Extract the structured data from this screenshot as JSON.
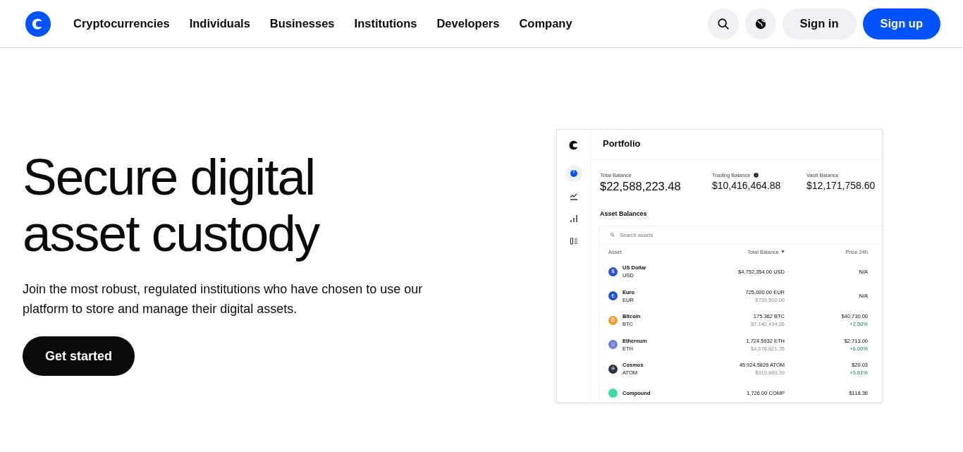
{
  "nav": {
    "links": [
      "Cryptocurrencies",
      "Individuals",
      "Businesses",
      "Institutions",
      "Developers",
      "Company"
    ],
    "sign_in": "Sign in",
    "sign_up": "Sign up"
  },
  "hero": {
    "title_lines": [
      "Secure digital",
      "asset custody"
    ],
    "subtitle": "Join the most robust, regulated institutions who have chosen to use our platform to store and manage their digital assets.",
    "cta": "Get started"
  },
  "portfolio": {
    "title": "Portfolio",
    "sidebar": [
      {
        "kind": "pie",
        "selected": true
      },
      {
        "kind": "trend",
        "selected": false
      },
      {
        "kind": "bars",
        "selected": false
      },
      {
        "kind": "list",
        "selected": false
      }
    ],
    "balances": [
      {
        "label": "Total Balance",
        "value": "$22,588,223.48",
        "info": false,
        "primary": true
      },
      {
        "label": "Trading Balance",
        "value": "$10,416,464.88",
        "info": true,
        "primary": false
      },
      {
        "label": "Vault Balance",
        "value": "$12,171,758.60",
        "info": false,
        "primary": false
      }
    ],
    "section_title": "Asset Balances",
    "search": {
      "placeholder": "Search assets"
    },
    "columns": [
      "Asset",
      "Total Balance",
      "Price 24h"
    ],
    "rows": [
      {
        "name": "US Dollar",
        "symbol": "USD",
        "glyph": "$",
        "color": "#2b50d8",
        "amount": "$4,752,354.00 USD",
        "fiat": "",
        "price": "N/A",
        "change": ""
      },
      {
        "name": "Euro",
        "symbol": "EUR",
        "glyph": "€",
        "color": "#1f4fd6",
        "amount": "725,000.00 EUR",
        "fiat": "$739,500.00",
        "price": "N/A",
        "change": ""
      },
      {
        "name": "Bitcoin",
        "symbol": "BTC",
        "glyph": "₿",
        "color": "#f39a2c",
        "amount": "175.362 BTC",
        "fiat": "$7,142,494.26",
        "price": "$40,730.00",
        "change": "+2.50%"
      },
      {
        "name": "Ethereum",
        "symbol": "ETH",
        "glyph": "Ξ",
        "color": "#6f7fe0",
        "amount": "1,724.5932 ETH",
        "fiat": "$4,678,821.35",
        "price": "$2,713.00",
        "change": "+6.00%"
      },
      {
        "name": "Cosmos",
        "symbol": "ATOM",
        "glyph": "⚛",
        "color": "#2e3148",
        "amount": "45,924.5826 ATOM",
        "fiat": "$919,869.39",
        "price": "$20.03",
        "change": "+5.61%"
      },
      {
        "name": "Compound",
        "symbol": "",
        "glyph": "",
        "color": "#3fd9a0",
        "amount": "1,726.00 COMP",
        "fiat": "",
        "price": "$118.36",
        "change": ""
      }
    ]
  }
}
